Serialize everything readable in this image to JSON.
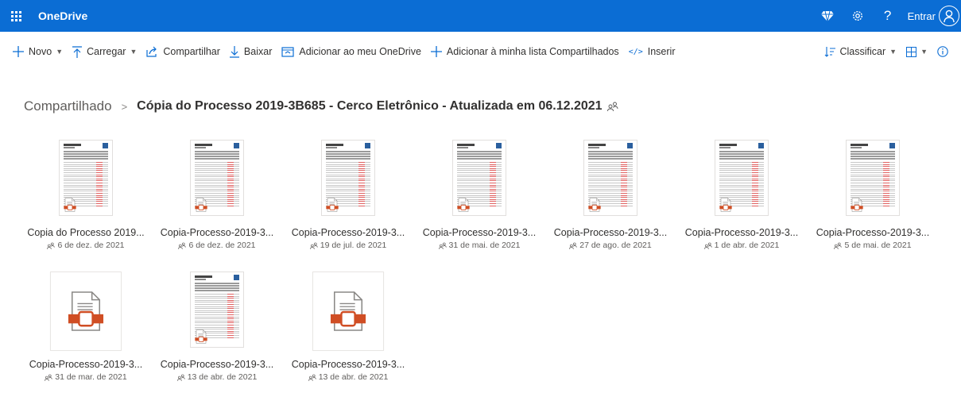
{
  "app": {
    "name": "OneDrive"
  },
  "header": {
    "signin_label": "Entrar"
  },
  "colors": {
    "accent": "#0b6dd4",
    "suitebar": "#0b6dd4",
    "pdf_badge": "#d04e24"
  },
  "commands": {
    "new": "Novo",
    "upload": "Carregar",
    "share": "Compartilhar",
    "download": "Baixar",
    "add_to_onedrive": "Adicionar ao meu OneDrive",
    "add_to_shared": "Adicionar à minha lista Compartilhados",
    "embed": "Inserir",
    "sort": "Classificar"
  },
  "breadcrumb": {
    "root": "Compartilhado",
    "current": "Cópia do Processo 2019-3B685 - Cerco Eletrônico - Atualizada em 06.12.2021"
  },
  "files": [
    {
      "name": "Copia do Processo 2019...",
      "date": "6 de dez. de 2021",
      "thumb": "document"
    },
    {
      "name": "Copia-Processo-2019-3...",
      "date": "6 de dez. de 2021",
      "thumb": "document"
    },
    {
      "name": "Copia-Processo-2019-3...",
      "date": "19 de jul. de 2021",
      "thumb": "document"
    },
    {
      "name": "Copia-Processo-2019-3...",
      "date": "31 de mai. de 2021",
      "thumb": "document"
    },
    {
      "name": "Copia-Processo-2019-3...",
      "date": "27 de ago. de 2021",
      "thumb": "document"
    },
    {
      "name": "Copia-Processo-2019-3...",
      "date": "1 de abr. de 2021",
      "thumb": "document"
    },
    {
      "name": "Copia-Processo-2019-3...",
      "date": "5 de mai. de 2021",
      "thumb": "document"
    },
    {
      "name": "Copia-Processo-2019-3...",
      "date": "31 de mar. de 2021",
      "thumb": "generic"
    },
    {
      "name": "Copia-Processo-2019-3...",
      "date": "13 de abr. de 2021",
      "thumb": "document"
    },
    {
      "name": "Copia-Processo-2019-3...",
      "date": "13 de abr. de 2021",
      "thumb": "generic"
    }
  ]
}
